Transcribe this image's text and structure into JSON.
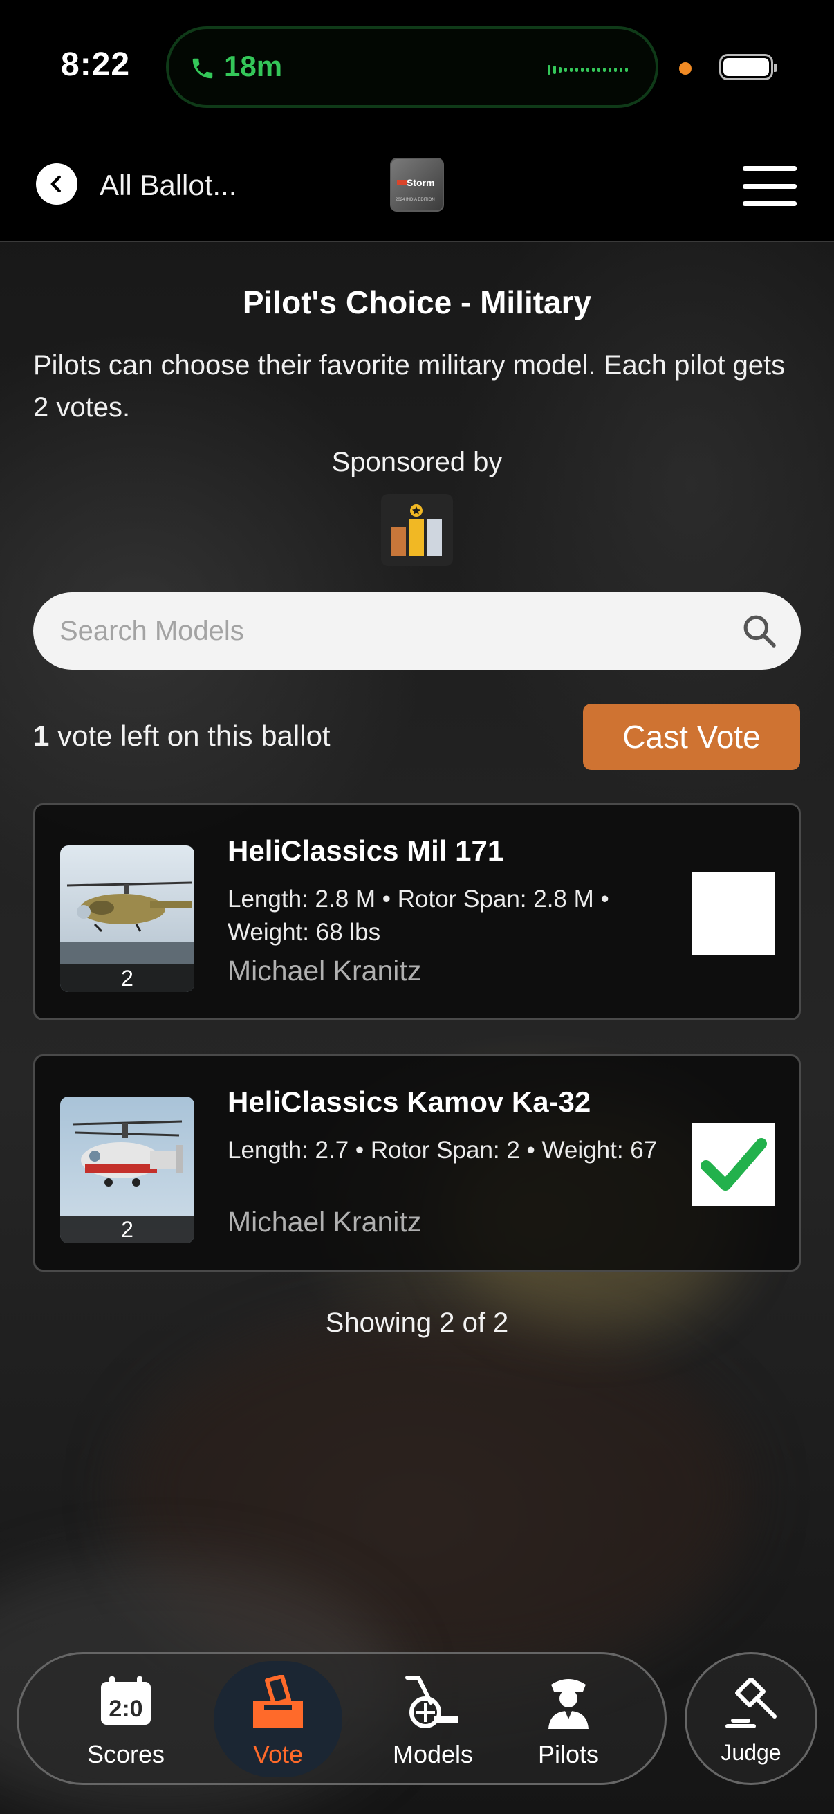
{
  "status_bar": {
    "time": "8:22",
    "call_duration": "18m"
  },
  "nav": {
    "back_label": "All Ballot...",
    "logo_text": "Storm",
    "logo_subtext": "2024 INDIA EDITION"
  },
  "ballot": {
    "title": "Pilot's Choice - Military",
    "description": "Pilots can choose their favorite military model. Each pilot gets 2 votes.",
    "sponsored_label": "Sponsored by"
  },
  "search": {
    "placeholder": "Search Models"
  },
  "votes": {
    "count": "1",
    "suffix": " vote left on this ballot",
    "cast_label": "Cast Vote"
  },
  "models": [
    {
      "name": "HeliClassics Mil 171",
      "specs": "Length: 2.8 M • Rotor Span: 2.8 M • Weight: 68 lbs",
      "owner": "Michael Kranitz",
      "photo_count": "2",
      "selected": false
    },
    {
      "name": "HeliClassics Kamov Ka-32",
      "specs": "Length: 2.7 • Rotor Span: 2 • Weight: 67",
      "owner": "Michael Kranitz",
      "photo_count": "2",
      "selected": true
    }
  ],
  "results": {
    "showing": "Showing 2 of 2"
  },
  "tabs": {
    "scores": "Scores",
    "vote": "Vote",
    "models": "Models",
    "pilots": "Pilots",
    "judge": "Judge",
    "active": "vote"
  },
  "colors": {
    "accent": "#cf7332",
    "active_tab": "#ff6a2a",
    "check": "#22b14c",
    "call_green": "#34c759"
  }
}
